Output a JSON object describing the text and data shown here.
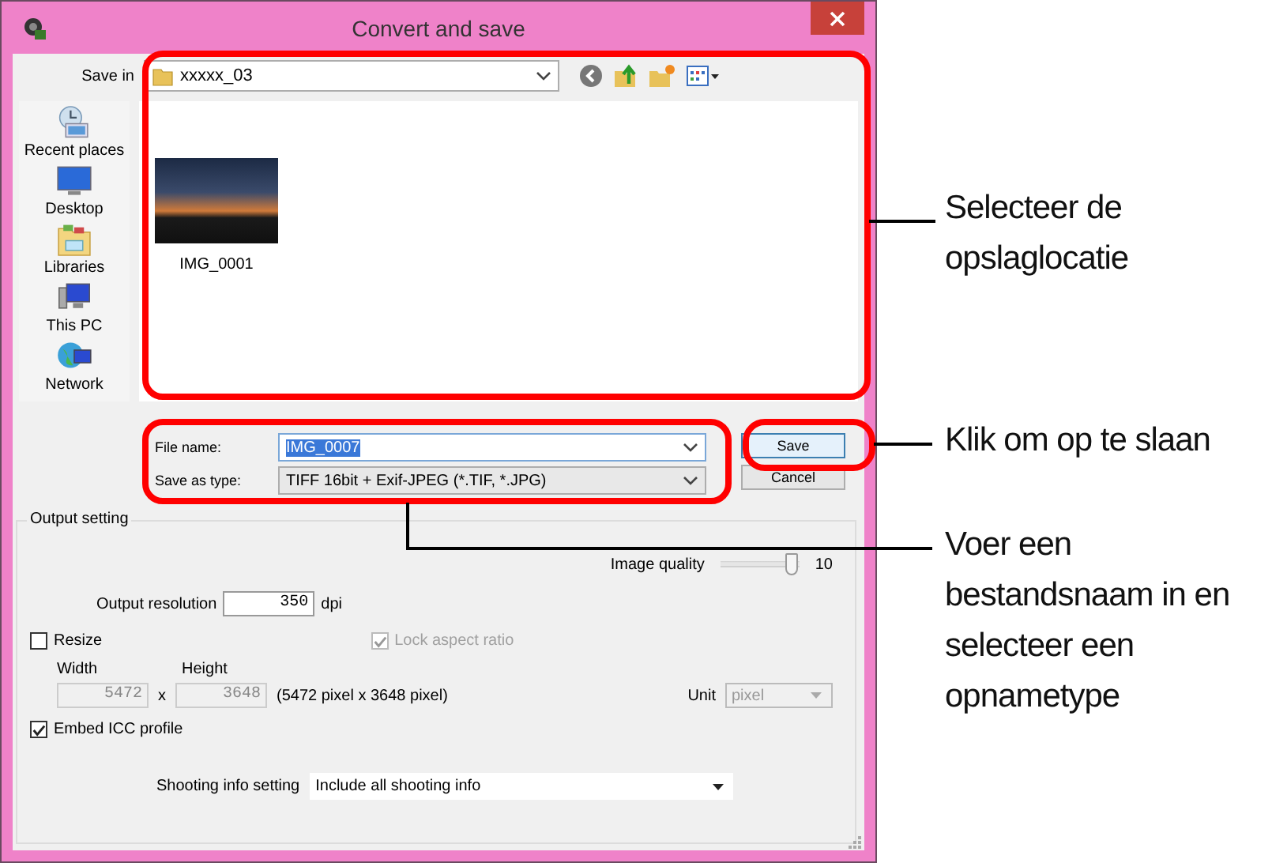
{
  "window": {
    "title": "Convert and save"
  },
  "save_in": {
    "label": "Save in",
    "folder": "xxxxx_03"
  },
  "places": [
    {
      "label": "Recent places",
      "kind": "recent"
    },
    {
      "label": "Desktop",
      "kind": "desktop"
    },
    {
      "label": "Libraries",
      "kind": "libraries"
    },
    {
      "label": "This PC",
      "kind": "pc"
    },
    {
      "label": "Network",
      "kind": "network"
    }
  ],
  "files": [
    {
      "name": "IMG_0001"
    }
  ],
  "file_name": {
    "label": "File name:",
    "value": "IMG_0007"
  },
  "save_as_type": {
    "label": "Save as type:",
    "value": "TIFF  16bit + Exif-JPEG (*.TIF, *.JPG)"
  },
  "buttons": [
    {
      "label": "Save",
      "kind": "default"
    },
    {
      "label": "Cancel",
      "kind": "normal"
    }
  ],
  "output_setting": {
    "title": "Output setting",
    "image_quality": {
      "label": "Image quality",
      "level": 0.9,
      "reading": "10"
    },
    "resolution": {
      "label": "Output resolution",
      "value": "350",
      "unit": "dpi"
    },
    "resize": {
      "label": "Resize",
      "checked": false
    },
    "lock_aspect": {
      "label": "Lock aspect ratio",
      "checked": true,
      "disabled": true
    },
    "width": {
      "label": "Width",
      "value": "5472",
      "disabled": true
    },
    "times": "x",
    "height": {
      "label": "Height",
      "value": "3648",
      "disabled": true
    },
    "pixel_info": "(5472 pixel x 3648 pixel)",
    "unit": {
      "label": "Unit",
      "value": "pixel",
      "disabled": true
    },
    "embed_icc": {
      "label": "Embed ICC profile",
      "checked": true
    },
    "shooting_info": {
      "label": "Shooting info setting",
      "value": "Include all shooting info"
    }
  },
  "callouts": [
    {
      "text": "Selecteer de opslaglocatie"
    },
    {
      "text": "Klik om op te slaan"
    },
    {
      "text": "Voer een bestandsnaam in en selecteer een opnametype"
    }
  ]
}
